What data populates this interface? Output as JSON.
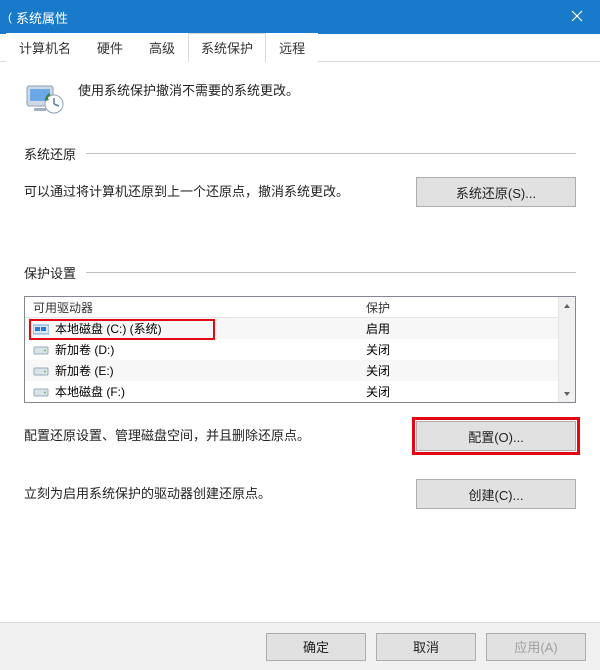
{
  "titlebar": {
    "title": "系统属性"
  },
  "tabs": [
    {
      "label": "计算机名",
      "active": false
    },
    {
      "label": "硬件",
      "active": false
    },
    {
      "label": "高级",
      "active": false
    },
    {
      "label": "系统保护",
      "active": true
    },
    {
      "label": "远程",
      "active": false
    }
  ],
  "intro": "使用系统保护撤消不需要的系统更改。",
  "section_restore": {
    "title": "系统还原",
    "desc": "可以通过将计算机还原到上一个还原点，撤消系统更改。",
    "button": "系统还原(S)..."
  },
  "section_settings": {
    "title": "保护设置",
    "columns": {
      "drive": "可用驱动器",
      "protection": "保护"
    },
    "drives": [
      {
        "name": "本地磁盘 (C:) (系统)",
        "status": "启用",
        "icon": "win"
      },
      {
        "name": "新加卷 (D:)",
        "status": "关闭",
        "icon": "hdd"
      },
      {
        "name": "新加卷 (E:)",
        "status": "关闭",
        "icon": "hdd"
      },
      {
        "name": "本地磁盘 (F:)",
        "status": "关闭",
        "icon": "hdd"
      }
    ],
    "configure_desc": "配置还原设置、管理磁盘空间，并且删除还原点。",
    "configure_button": "配置(O)...",
    "create_desc": "立刻为启用系统保护的驱动器创建还原点。",
    "create_button": "创建(C)..."
  },
  "footer": {
    "ok": "确定",
    "cancel": "取消",
    "apply": "应用(A)"
  }
}
